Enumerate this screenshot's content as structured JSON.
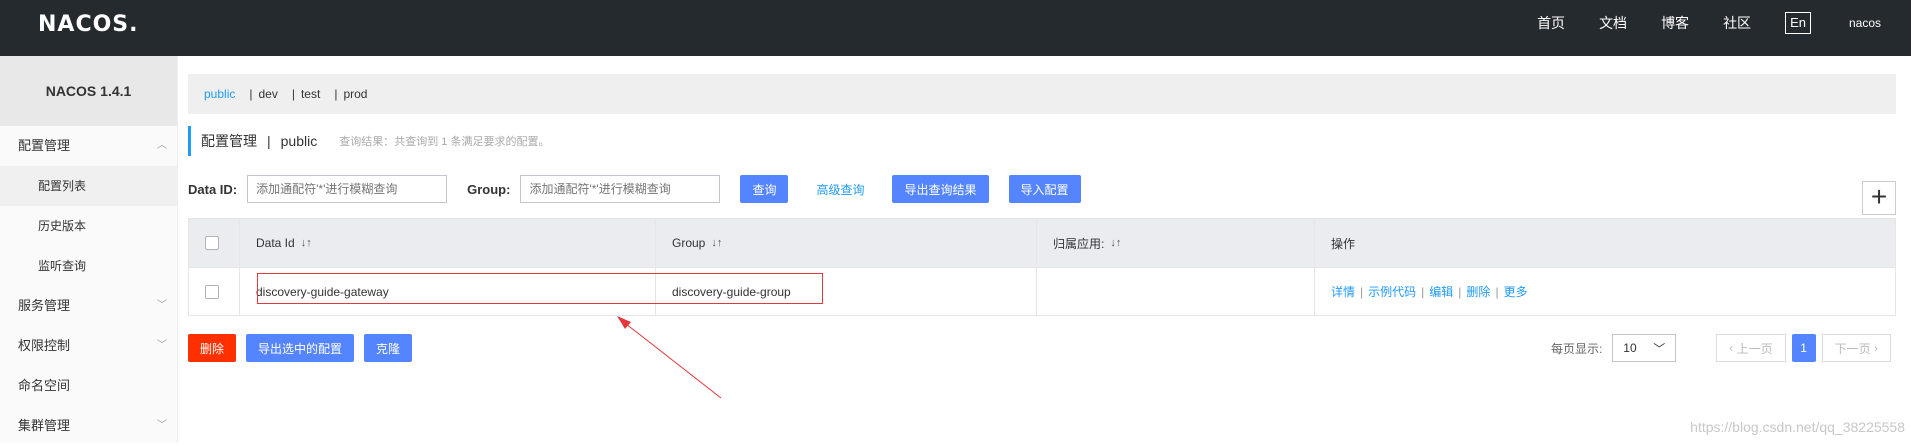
{
  "topbar": {
    "logo": "NACOS.",
    "links": [
      "首页",
      "文档",
      "博客",
      "社区"
    ],
    "lang": "En",
    "user": "nacos"
  },
  "sidebar": {
    "version": "NACOS 1.4.1",
    "items": [
      {
        "label": "配置管理",
        "caret": "up"
      },
      {
        "label": "配置列表"
      },
      {
        "label": "历史版本"
      },
      {
        "label": "监听查询"
      },
      {
        "label": "服务管理",
        "caret": "down"
      },
      {
        "label": "权限控制",
        "caret": "down"
      },
      {
        "label": "命名空间"
      },
      {
        "label": "集群管理",
        "caret": "down"
      }
    ]
  },
  "namespaces": [
    "public",
    "dev",
    "test",
    "prod"
  ],
  "header": {
    "title": "配置管理",
    "namespace": "public",
    "desc": "查询结果：共查询到 1 条满足要求的配置。"
  },
  "search": {
    "dataid_label": "Data ID:",
    "dataid_placeholder": "添加通配符'*'进行模糊查询",
    "group_label": "Group:",
    "group_placeholder": "添加通配符'*'进行模糊查询",
    "query": "查询",
    "advanced": "高级查询",
    "export_results": "导出查询结果",
    "import": "导入配置"
  },
  "table": {
    "headers": [
      "Data Id",
      "Group",
      "归属应用:",
      "操作"
    ],
    "rows": [
      {
        "data_id": "discovery-guide-gateway",
        "group": "discovery-guide-group",
        "app": ""
      }
    ],
    "ops": [
      "详情",
      "示例代码",
      "编辑",
      "删除",
      "更多"
    ]
  },
  "bottom": {
    "delete": "删除",
    "export_selected": "导出选中的配置",
    "clone": "克隆"
  },
  "pager": {
    "label": "每页显示:",
    "size": "10",
    "prev": "上一页",
    "page": "1",
    "next": "下一页"
  },
  "watermark": "https://blog.csdn.net/qq_38225558"
}
